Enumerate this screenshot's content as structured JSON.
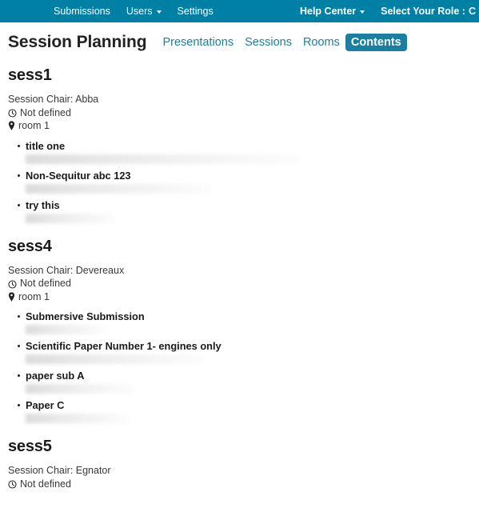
{
  "topnav": {
    "left_items": [
      {
        "label": "Submissions",
        "has_caret": false
      },
      {
        "label": "Users",
        "has_caret": true
      },
      {
        "label": "Settings",
        "has_caret": false
      }
    ],
    "help_center": {
      "label": "Help Center",
      "has_caret": true
    },
    "role_label": "Select Your Role :",
    "role_value": "C",
    "background_color": "#0080a5",
    "text_color": "#ffffff"
  },
  "page": {
    "title": "Session Planning",
    "tabs": [
      {
        "label": "Presentations",
        "active": false
      },
      {
        "label": "Sessions",
        "active": false
      },
      {
        "label": "Rooms",
        "active": false
      },
      {
        "label": "Contents",
        "active": true
      }
    ],
    "accent_color": "#1a7fa0",
    "link_color": "#1a7fa0"
  },
  "sessions": [
    {
      "name": "sess1",
      "chair": "Session Chair: Abba",
      "time": "Not defined",
      "time_icon": "clock-icon",
      "room": "room 1",
      "room_icon": "map-pin-icon",
      "papers": [
        {
          "title": "title one",
          "authors": "",
          "authors_redacted": true,
          "authors_width": "w-long"
        },
        {
          "title": "Non-Sequitur abc 123",
          "authors": "",
          "authors_redacted": true,
          "authors_width": "w-mid"
        },
        {
          "title": "try this",
          "authors": "",
          "authors_redacted": true,
          "authors_width": "w-short"
        }
      ]
    },
    {
      "name": "sess4",
      "chair": "Session Chair: Devereaux",
      "time": "Not defined",
      "time_icon": "clock-icon",
      "room": "room 1",
      "room_icon": "map-pin-icon",
      "papers": [
        {
          "title": "Submersive Submission",
          "authors": "",
          "authors_redacted": true,
          "authors_width": "w-xs"
        },
        {
          "title": "Scientific Paper Number 1- engines only",
          "authors": "",
          "authors_redacted": true,
          "authors_width": "w-med"
        },
        {
          "title": "paper sub A",
          "authors": "",
          "authors_redacted": true,
          "authors_width": "w-sm"
        },
        {
          "title": "Paper C",
          "authors": "",
          "authors_redacted": true,
          "authors_width": "w-s2"
        }
      ]
    },
    {
      "name": "sess5",
      "chair": "Session Chair: Egnator",
      "time": "Not defined",
      "time_icon": "clock-icon",
      "room": "",
      "room_icon": "map-pin-icon",
      "papers": []
    }
  ]
}
